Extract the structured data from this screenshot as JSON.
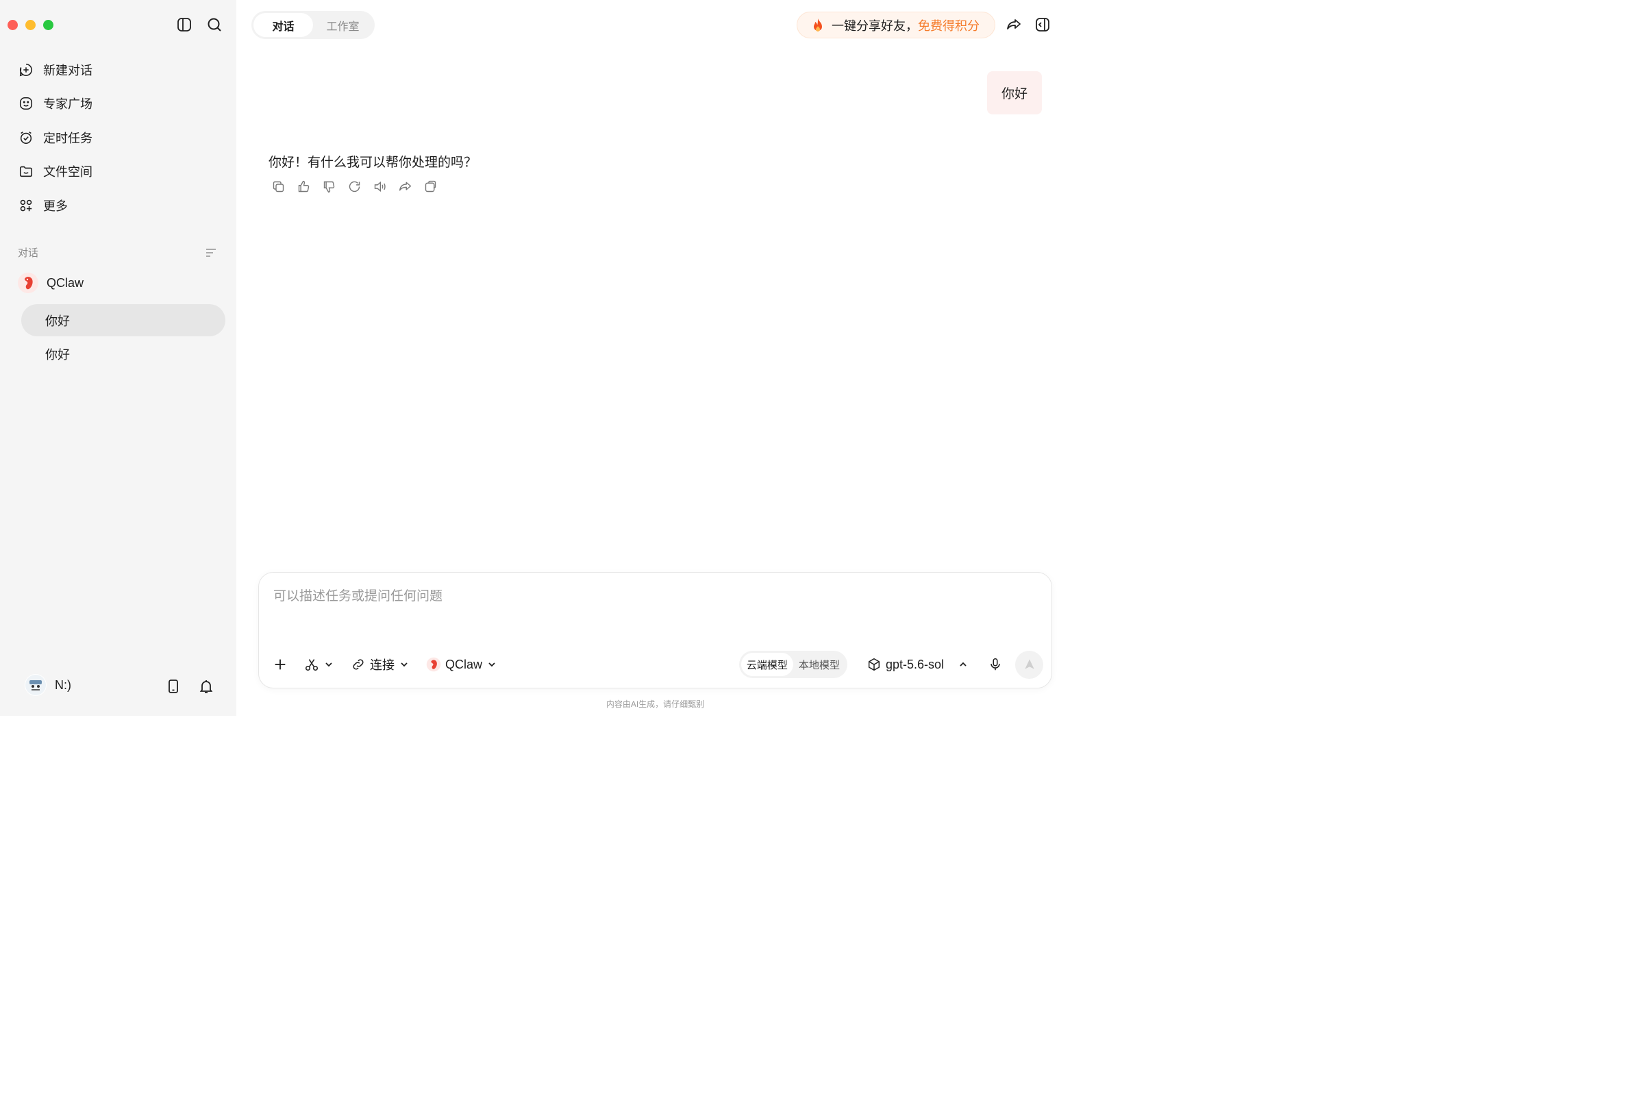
{
  "sidebar": {
    "nav": [
      {
        "label": "新建对话",
        "icon": "plus-circle-icon"
      },
      {
        "label": "专家广场",
        "icon": "smile-face-icon"
      },
      {
        "label": "定时任务",
        "icon": "alarm-clock-icon"
      },
      {
        "label": "文件空间",
        "icon": "folder-icon"
      },
      {
        "label": "更多",
        "icon": "apps-grid-icon"
      }
    ],
    "section_title": "对话",
    "agent": {
      "name": "QClaw"
    },
    "conversations": [
      {
        "title": "你好",
        "active": true
      },
      {
        "title": "你好",
        "active": false
      }
    ],
    "user": {
      "name": "N:)"
    }
  },
  "header": {
    "tabs": [
      {
        "label": "对话",
        "active": true
      },
      {
        "label": "工作室",
        "active": false
      }
    ],
    "promo": {
      "text": "一键分享好友，",
      "accent": "免费得积分",
      "accent_color": "#f57c2c"
    }
  },
  "chat": {
    "user_message": "你好",
    "ai_message": "你好！有什么我可以帮你处理的吗？",
    "actions": [
      "copy-icon",
      "thumbs-up-icon",
      "thumbs-down-icon",
      "refresh-icon",
      "speaker-icon",
      "share-icon",
      "new-chat-icon"
    ]
  },
  "composer": {
    "placeholder": "可以描述任务或提问任何问题",
    "connect_label": "连接",
    "agent_label": "QClaw",
    "model_switch": {
      "cloud": "云端模型",
      "local": "本地模型",
      "selected": "cloud"
    },
    "model_name": "gpt-5.6-sol"
  },
  "disclaimer": "内容由AI生成，请仔细甄别",
  "colors": {
    "sidebar_bg": "#f5f5f5",
    "user_bubble": "#fdf0ef",
    "accent_orange": "#f57c2c"
  }
}
